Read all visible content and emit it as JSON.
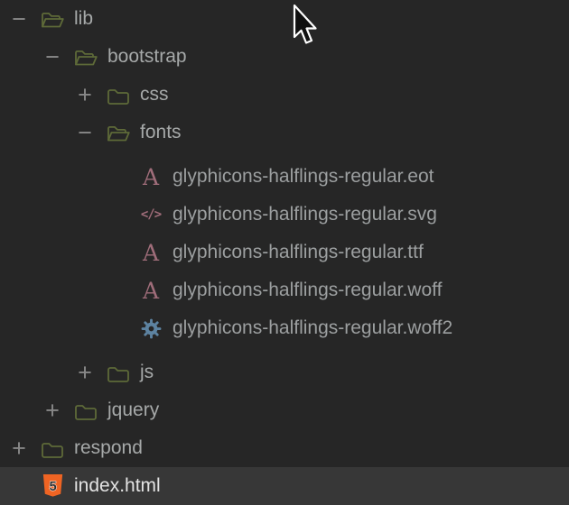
{
  "colors": {
    "bg": "#262626",
    "row_selected_bg": "#373737",
    "text_folder": "#a6a9a9",
    "text_file": "#9c9fa0",
    "text_selected": "#e3e3e3",
    "toggle": "#878787",
    "folder_outline": "#5e6a38",
    "font_icon": "#a06d7a",
    "gear_icon": "#5d83a1",
    "html5_orange": "#ef6423"
  },
  "toggles": {
    "expanded": "−",
    "collapsed": "+"
  },
  "tree": {
    "rows": [
      {
        "label": "lib",
        "level": 0,
        "kind": "folder",
        "state": "expanded",
        "icon": "folder-open-icon"
      },
      {
        "label": "bootstrap",
        "level": 1,
        "kind": "folder",
        "state": "expanded",
        "icon": "folder-open-icon"
      },
      {
        "label": "css",
        "level": 2,
        "kind": "folder",
        "state": "collapsed",
        "icon": "folder-closed-icon"
      },
      {
        "label": "fonts",
        "level": 2,
        "kind": "folder",
        "state": "expanded",
        "icon": "folder-open-icon"
      },
      {
        "label": "glyphicons-halflings-regular.eot",
        "level": 3,
        "kind": "file",
        "icon": "font-file-icon",
        "gap_above": true
      },
      {
        "label": "glyphicons-halflings-regular.svg",
        "level": 3,
        "kind": "file",
        "icon": "code-file-icon"
      },
      {
        "label": "glyphicons-halflings-regular.ttf",
        "level": 3,
        "kind": "file",
        "icon": "font-file-icon"
      },
      {
        "label": "glyphicons-halflings-regular.woff",
        "level": 3,
        "kind": "file",
        "icon": "font-file-icon"
      },
      {
        "label": "glyphicons-halflings-regular.woff2",
        "level": 3,
        "kind": "file",
        "icon": "gear-icon"
      },
      {
        "label": "js",
        "level": 2,
        "kind": "folder",
        "state": "collapsed",
        "icon": "folder-closed-icon",
        "gap_above": true
      },
      {
        "label": "jquery",
        "level": 1,
        "kind": "folder",
        "state": "collapsed",
        "icon": "folder-closed-icon"
      },
      {
        "label": "respond",
        "level": 0,
        "kind": "folder",
        "state": "collapsed",
        "icon": "folder-closed-icon"
      },
      {
        "label": "index.html",
        "level": 0,
        "kind": "file",
        "icon": "html5-icon",
        "selected": true
      }
    ]
  }
}
